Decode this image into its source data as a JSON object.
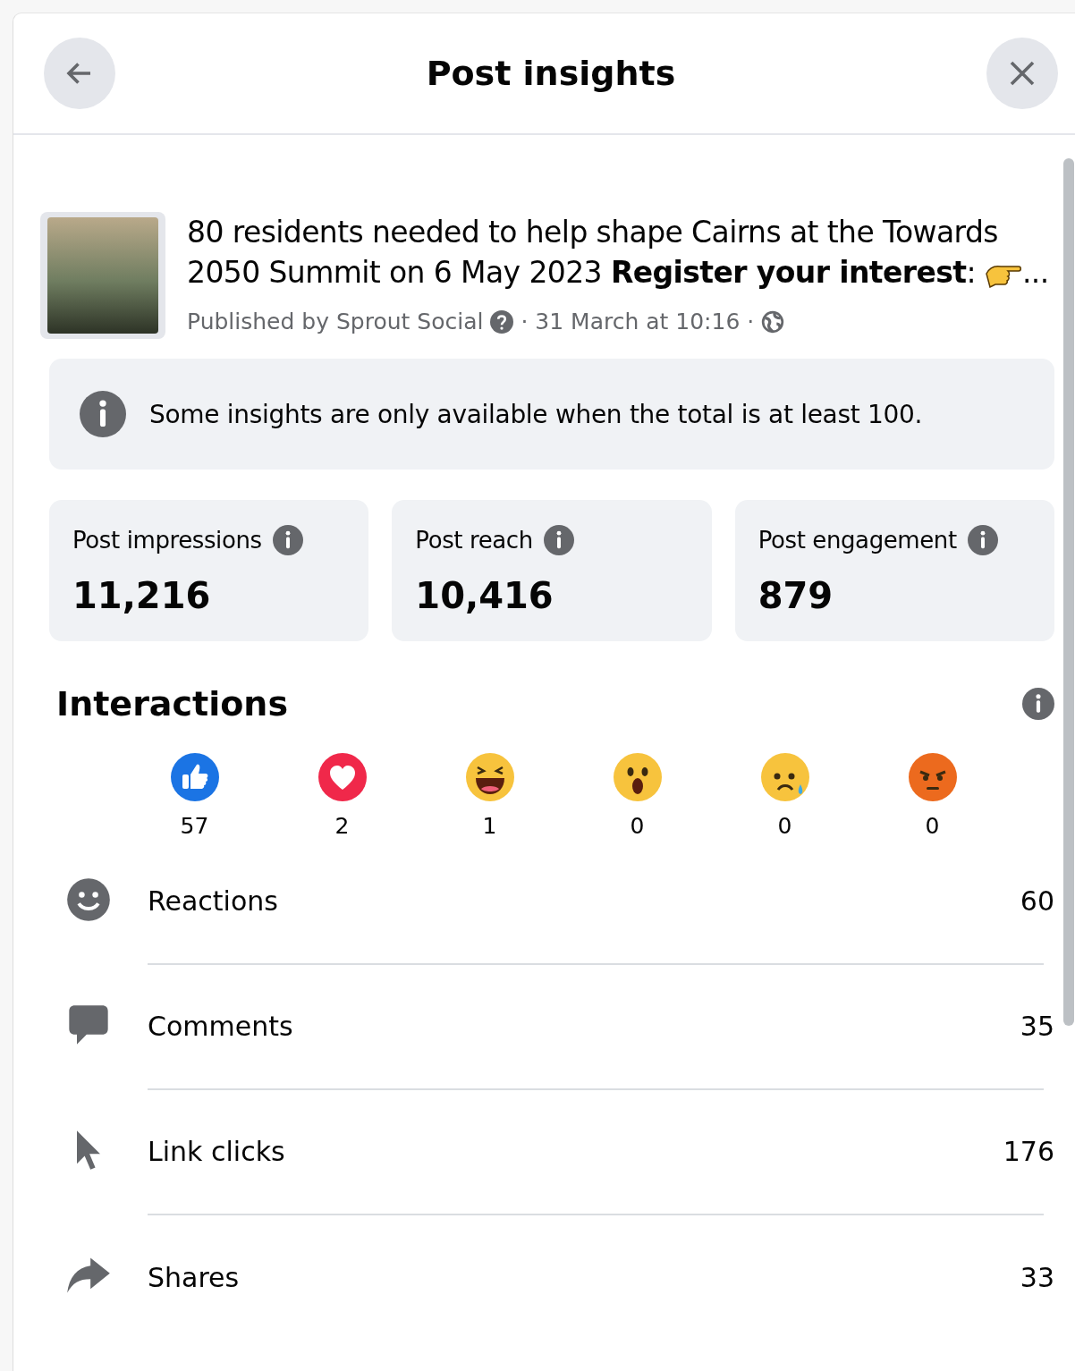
{
  "header": {
    "title": "Post insights"
  },
  "post": {
    "text": "80 residents needed to help shape Cairns at the Towards 2050 Summit on 6 May 2023 **Register your interest**:",
    "more": "...",
    "publisher": "Published by Sprout Social",
    "date": "· 31 March at 10:16 ·"
  },
  "notice": {
    "text": "Some insights are only available when the total is at least 100."
  },
  "stats": [
    {
      "label": "Post impressions",
      "value": "11,216"
    },
    {
      "label": "Post reach",
      "value": "10,416"
    },
    {
      "label": "Post engagement",
      "value": "879"
    }
  ],
  "interactions": {
    "title": "Interactions",
    "reactions": [
      {
        "kind": "like",
        "count": "57"
      },
      {
        "kind": "love",
        "count": "2"
      },
      {
        "kind": "haha",
        "count": "1"
      },
      {
        "kind": "wow",
        "count": "0"
      },
      {
        "kind": "sad",
        "count": "0"
      },
      {
        "kind": "angry",
        "count": "0"
      }
    ],
    "rows": [
      {
        "kind": "reactions",
        "label": "Reactions",
        "value": "60"
      },
      {
        "kind": "comments",
        "label": "Comments",
        "value": "35"
      },
      {
        "kind": "clicks",
        "label": "Link clicks",
        "value": "176"
      },
      {
        "kind": "shares",
        "label": "Shares",
        "value": "33"
      }
    ]
  }
}
